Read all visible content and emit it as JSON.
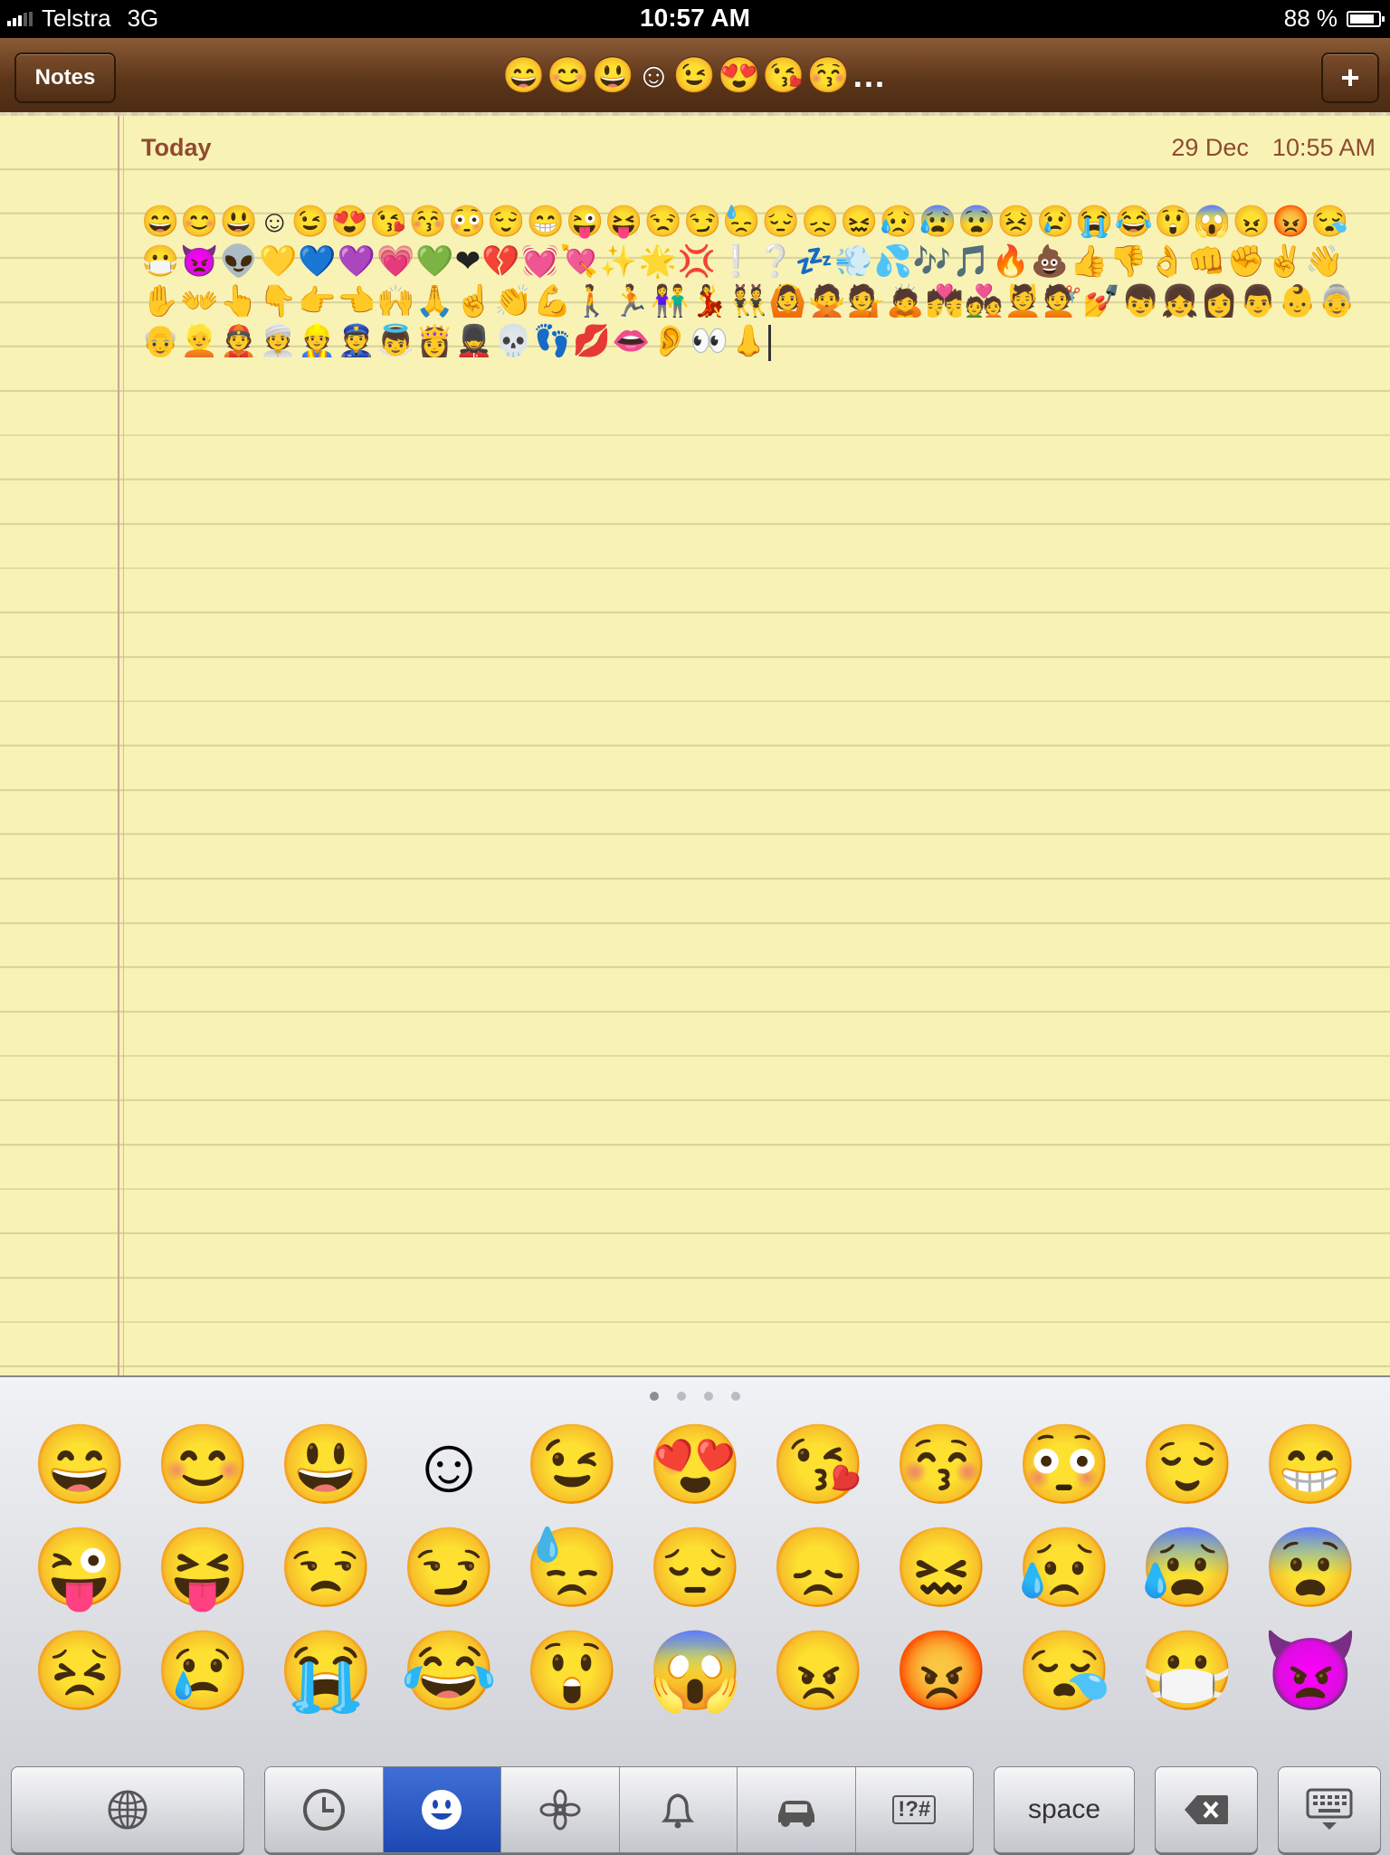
{
  "status_bar": {
    "carrier": "Telstra",
    "network": "3G",
    "time": "10:57 AM",
    "battery_percent": "88 %",
    "battery_level": 0.88
  },
  "nav_bar": {
    "back_label": "Notes",
    "title": "😄😊😃☺😉😍😘😚…",
    "add_label": "+"
  },
  "note": {
    "day_label": "Today",
    "date": "29 Dec",
    "time": "10:55 AM",
    "body": "😄😊😃☺😉😍😘😚😳😌😁😜😝😒😏😓😔😞😖😥😰😨😣😢😭😂😲😱😠😡😪😷👿👽💛💙💜💗💚❤💔💓💘✨🌟💢❕❔💤💨💦🎶🎵🔥💩👍👎👌👊✊✌👋✋👐👆👇👉👈🙌🙏☝👏💪🚶🏃👫💃👯🙆🙅💁🙇💏💑💆💇💅👦👧👩👨👶👵👴👱👲👳👷👮👼👸💂💀👣💋👄👂👀👃"
  },
  "keyboard": {
    "page_count": 4,
    "active_page": 1,
    "emoji_keys": [
      "😄",
      "😊",
      "😃",
      "☺",
      "😉",
      "😍",
      "😘",
      "😚",
      "😳",
      "😌",
      "😁",
      "😜",
      "😝",
      "😒",
      "😏",
      "😓",
      "😔",
      "😞",
      "😖",
      "😥",
      "😰",
      "😨",
      "😣",
      "😢",
      "😭",
      "😂",
      "😲",
      "😱",
      "😠",
      "😡",
      "😪",
      "😷",
      "👿"
    ],
    "space_label": "space",
    "category_symbols_label": "!?#",
    "category_icons": [
      "clock-icon",
      "smiley-icon",
      "flower-icon",
      "bell-icon",
      "car-icon",
      "symbols-icon"
    ],
    "active_category": "smiley-icon"
  }
}
